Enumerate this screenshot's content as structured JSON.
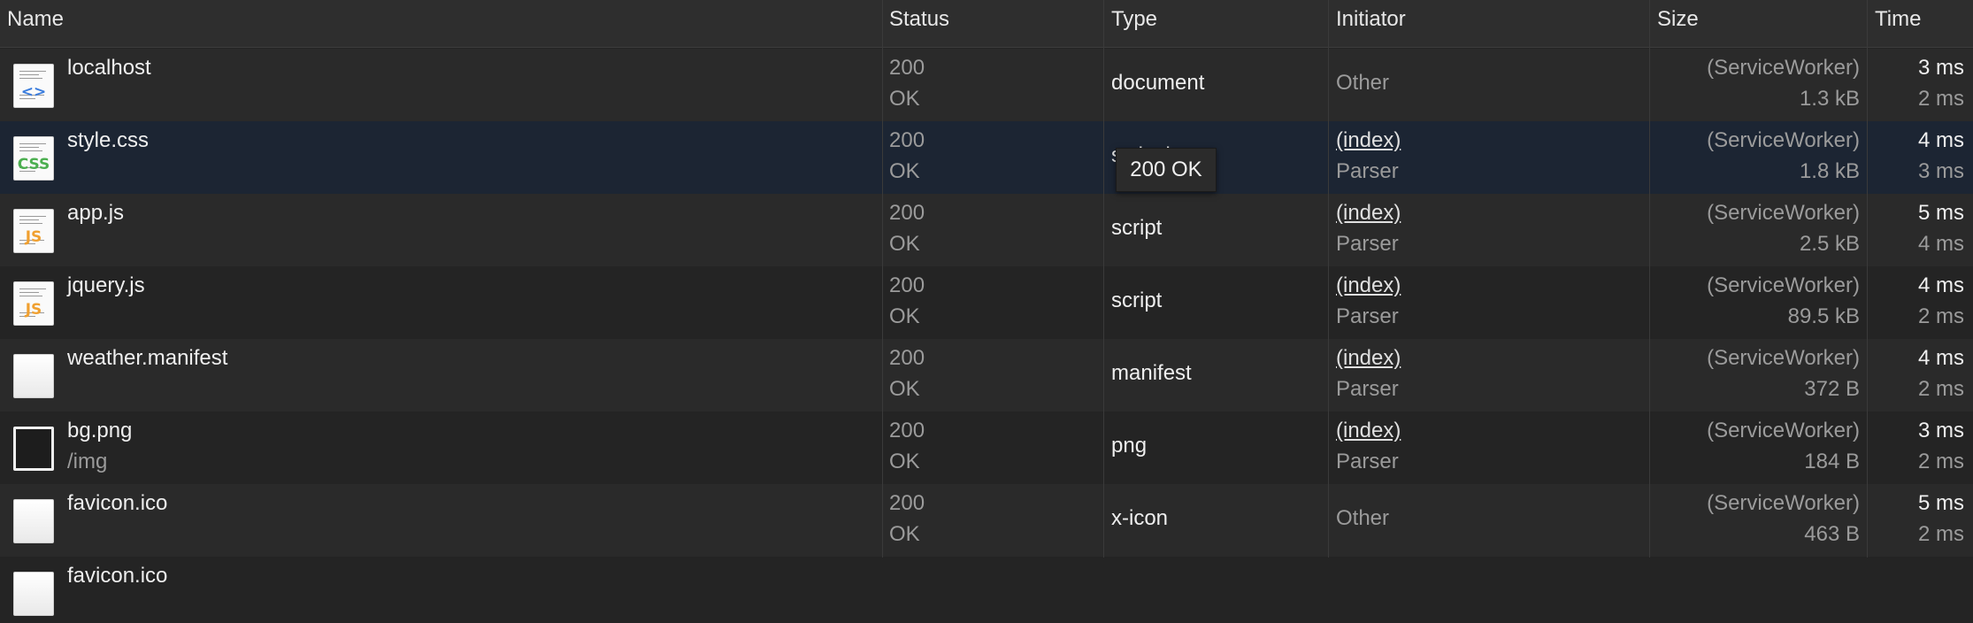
{
  "headers": {
    "name": "Name",
    "status": "Status",
    "type": "Type",
    "initiator": "Initiator",
    "size": "Size",
    "time": "Time"
  },
  "rows": [
    {
      "name": "localhost",
      "path": "",
      "icon": "html-file-icon",
      "glyph": "<>",
      "status_code": "200",
      "status_text": "OK",
      "type": "document",
      "initiator": "",
      "initiator_sub": "Other",
      "size_top": "(ServiceWorker)",
      "size_bottom": "1.3 kB",
      "time_top": "3 ms",
      "time_bottom": "2 ms"
    },
    {
      "name": "style.css",
      "path": "",
      "icon": "css-file-icon",
      "glyph": "CSS",
      "status_code": "200",
      "status_text": "OK",
      "type": "stylesheet",
      "initiator": "(index)",
      "initiator_sub": "Parser",
      "size_top": "(ServiceWorker)",
      "size_bottom": "1.8 kB",
      "time_top": "4 ms",
      "time_bottom": "3 ms"
    },
    {
      "name": "app.js",
      "path": "",
      "icon": "js-file-icon",
      "glyph": "JS",
      "status_code": "200",
      "status_text": "OK",
      "type": "script",
      "initiator": "(index)",
      "initiator_sub": "Parser",
      "size_top": "(ServiceWorker)",
      "size_bottom": "2.5 kB",
      "time_top": "5 ms",
      "time_bottom": "4 ms"
    },
    {
      "name": "jquery.js",
      "path": "",
      "icon": "js-file-icon",
      "glyph": "JS",
      "status_code": "200",
      "status_text": "OK",
      "type": "script",
      "initiator": "(index)",
      "initiator_sub": "Parser",
      "size_top": "(ServiceWorker)",
      "size_bottom": "89.5 kB",
      "time_top": "4 ms",
      "time_bottom": "2 ms"
    },
    {
      "name": "weather.manifest",
      "path": "",
      "icon": "blank-file-icon",
      "glyph": "",
      "status_code": "200",
      "status_text": "OK",
      "type": "manifest",
      "initiator": "(index)",
      "initiator_sub": "Parser",
      "size_top": "(ServiceWorker)",
      "size_bottom": "372 B",
      "time_top": "4 ms",
      "time_bottom": "2 ms"
    },
    {
      "name": "bg.png",
      "path": "/img",
      "icon": "image-file-icon",
      "glyph": "",
      "status_code": "200",
      "status_text": "OK",
      "type": "png",
      "initiator": "(index)",
      "initiator_sub": "Parser",
      "size_top": "(ServiceWorker)",
      "size_bottom": "184 B",
      "time_top": "3 ms",
      "time_bottom": "2 ms"
    },
    {
      "name": "favicon.ico",
      "path": "",
      "icon": "blank-file-icon",
      "glyph": "",
      "status_code": "200",
      "status_text": "OK",
      "type": "x-icon",
      "initiator": "",
      "initiator_sub": "Other",
      "size_top": "(ServiceWorker)",
      "size_bottom": "463 B",
      "time_top": "5 ms",
      "time_bottom": "2 ms"
    },
    {
      "name": "favicon.ico",
      "path": "",
      "icon": "blank-file-icon",
      "glyph": "",
      "status_code": "",
      "status_text": "",
      "type": "",
      "initiator": "",
      "initiator_sub": "",
      "size_top": "",
      "size_bottom": "",
      "time_top": "",
      "time_bottom": ""
    }
  ],
  "tooltip": "200 OK",
  "colors": {
    "background": "#242424",
    "selected_row": "#1c2533",
    "html_glyph": "#3b7ddd",
    "css_glyph": "#4caf50",
    "js_glyph": "#f0a030"
  }
}
